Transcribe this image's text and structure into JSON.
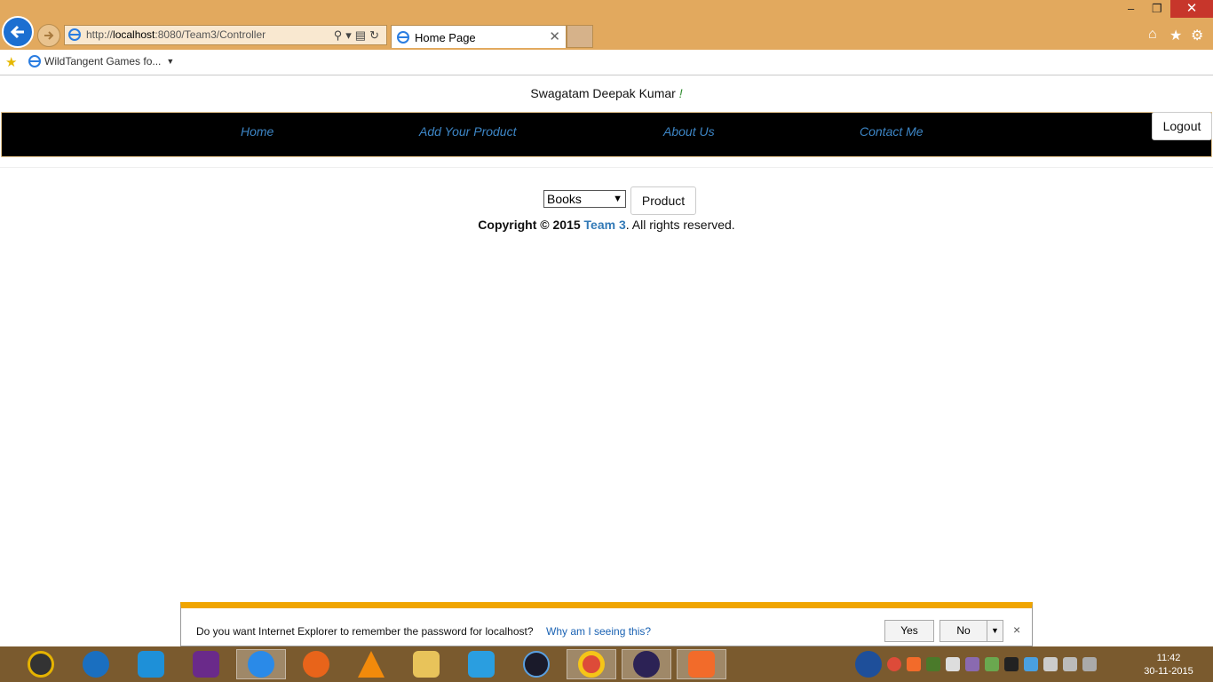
{
  "browser": {
    "url_prefix": "http://",
    "url_host": "localhost",
    "url_rest": ":8080/Team3/Controller",
    "tab_title": "Home Page",
    "favorite_label": "WildTangent Games fo...",
    "win_min": "–",
    "win_max": "❐",
    "win_close": "✕",
    "tab_close": "✕"
  },
  "page": {
    "greeting": "Swagatam Deepak Kumar",
    "greeting_bang": "!",
    "nav": [
      "Home",
      "Add Your Product",
      "About Us",
      "Contact Me"
    ],
    "logout": "Logout",
    "category_selected": "Books",
    "product_button": "Product",
    "copyright_prefix": "Copyright © 2015",
    "copyright_team": "Team 3",
    "copyright_suffix": ". All rights reserved."
  },
  "password_bar": {
    "question": "Do you want Internet Explorer to remember the password for localhost?",
    "why_link": "Why am I seeing this?",
    "yes": "Yes",
    "no": "No",
    "close": "×"
  },
  "taskbar": {
    "time": "11:42",
    "date": "30-11-2015",
    "apps": [
      "media-player-icon",
      "hp-icon",
      "rocket-icon",
      "puzzle-icon",
      "internet-explorer-icon",
      "firefox-icon",
      "vlc-icon",
      "file-explorer-icon",
      "video-icon",
      "eye-icon",
      "chrome-icon",
      "eclipse-icon",
      "xampp-icon"
    ]
  },
  "colors": {
    "chrome_bg": "#e2a95e",
    "navbar_bg": "#000000",
    "nav_link": "#3d86c6",
    "team_link": "#337ab7",
    "pwbar_accent": "#f0a500",
    "taskbar_bg": "#7a5a2e"
  }
}
